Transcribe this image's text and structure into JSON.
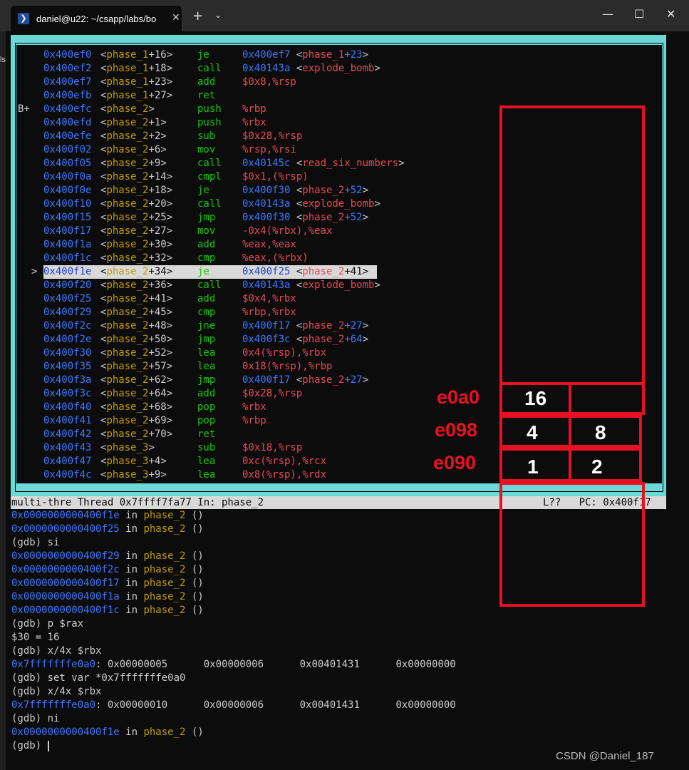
{
  "window": {
    "tab_title": "daniel@u22: ~/csapp/labs/bo",
    "tab_icon": "terminal-icon",
    "tab_close": "✕",
    "new_tab": "+",
    "dropdown": "⌄",
    "minimize": "—",
    "maximize": "☐",
    "close": "✕",
    "side_text": "ls"
  },
  "asm": {
    "lines": [
      {
        "marker": "",
        "addr": "0x400ef0",
        "func": "phase_1",
        "off": "+16",
        "op": "je",
        "t1": "0x400ef7",
        "tsym": "phase_1",
        "toff": "+23"
      },
      {
        "marker": "",
        "addr": "0x400ef2",
        "func": "phase_1",
        "off": "+18",
        "op": "call",
        "t1": "0x40143a",
        "tsym": "explode_bomb",
        "toff": ""
      },
      {
        "marker": "",
        "addr": "0x400ef7",
        "func": "phase_1",
        "off": "+23",
        "op": "add",
        "plain": "$0x8,%rsp"
      },
      {
        "marker": "",
        "addr": "0x400efb",
        "func": "phase_1",
        "off": "+27",
        "op": "ret",
        "plain": ""
      },
      {
        "marker": "B+",
        "addr": "0x400efc",
        "func": "phase_2",
        "off": "",
        "op": "push",
        "plain": "%rbp"
      },
      {
        "marker": "",
        "addr": "0x400efd",
        "func": "phase_2",
        "off": "+1",
        "op": "push",
        "plain": "%rbx"
      },
      {
        "marker": "",
        "addr": "0x400efe",
        "func": "phase_2",
        "off": "+2",
        "op": "sub",
        "plain": "$0x28,%rsp"
      },
      {
        "marker": "",
        "addr": "0x400f02",
        "func": "phase_2",
        "off": "+6",
        "op": "mov",
        "plain": "%rsp,%rsi"
      },
      {
        "marker": "",
        "addr": "0x400f05",
        "func": "phase_2",
        "off": "+9",
        "op": "call",
        "t1": "0x40145c",
        "tsym": "read_six_numbers",
        "toff": ""
      },
      {
        "marker": "",
        "addr": "0x400f0a",
        "func": "phase_2",
        "off": "+14",
        "op": "cmpl",
        "plain": "$0x1,(%rsp)"
      },
      {
        "marker": "",
        "addr": "0x400f0e",
        "func": "phase_2",
        "off": "+18",
        "op": "je",
        "t1": "0x400f30",
        "tsym": "phase_2",
        "toff": "+52"
      },
      {
        "marker": "",
        "addr": "0x400f10",
        "func": "phase_2",
        "off": "+20",
        "op": "call",
        "t1": "0x40143a",
        "tsym": "explode_bomb",
        "toff": ""
      },
      {
        "marker": "",
        "addr": "0x400f15",
        "func": "phase_2",
        "off": "+25",
        "op": "jmp",
        "t1": "0x400f30",
        "tsym": "phase_2",
        "toff": "+52"
      },
      {
        "marker": "",
        "addr": "0x400f17",
        "func": "phase_2",
        "off": "+27",
        "op": "mov",
        "plain": "-0x4(%rbx),%eax"
      },
      {
        "marker": "",
        "addr": "0x400f1a",
        "func": "phase_2",
        "off": "+30",
        "op": "add",
        "plain": "%eax,%eax"
      },
      {
        "marker": "",
        "addr": "0x400f1c",
        "func": "phase_2",
        "off": "+32",
        "op": "cmp",
        "plain": "%eax,(%rbx)"
      },
      {
        "marker": ">",
        "addr": "0x400f1e",
        "func": "phase_2",
        "off": "+34",
        "op": "je",
        "t1": "0x400f25",
        "tsym": "phase_2",
        "toff": "+41",
        "current": true
      },
      {
        "marker": "",
        "addr": "0x400f20",
        "func": "phase_2",
        "off": "+36",
        "op": "call",
        "t1": "0x40143a",
        "tsym": "explode_bomb",
        "toff": ""
      },
      {
        "marker": "",
        "addr": "0x400f25",
        "func": "phase_2",
        "off": "+41",
        "op": "add",
        "plain": "$0x4,%rbx"
      },
      {
        "marker": "",
        "addr": "0x400f29",
        "func": "phase_2",
        "off": "+45",
        "op": "cmp",
        "plain": "%rbp,%rbx"
      },
      {
        "marker": "",
        "addr": "0x400f2c",
        "func": "phase_2",
        "off": "+48",
        "op": "jne",
        "t1": "0x400f17",
        "tsym": "phase_2",
        "toff": "+27"
      },
      {
        "marker": "",
        "addr": "0x400f2e",
        "func": "phase_2",
        "off": "+50",
        "op": "jmp",
        "t1": "0x400f3c",
        "tsym": "phase_2",
        "toff": "+64"
      },
      {
        "marker": "",
        "addr": "0x400f30",
        "func": "phase_2",
        "off": "+52",
        "op": "lea",
        "plain": "0x4(%rsp),%rbx"
      },
      {
        "marker": "",
        "addr": "0x400f35",
        "func": "phase_2",
        "off": "+57",
        "op": "lea",
        "plain": "0x18(%rsp),%rbp"
      },
      {
        "marker": "",
        "addr": "0x400f3a",
        "func": "phase_2",
        "off": "+62",
        "op": "jmp",
        "t1": "0x400f17",
        "tsym": "phase_2",
        "toff": "+27"
      },
      {
        "marker": "",
        "addr": "0x400f3c",
        "func": "phase_2",
        "off": "+64",
        "op": "add",
        "plain": "$0x28,%rsp"
      },
      {
        "marker": "",
        "addr": "0x400f40",
        "func": "phase_2",
        "off": "+68",
        "op": "pop",
        "plain": "%rbx"
      },
      {
        "marker": "",
        "addr": "0x400f41",
        "func": "phase_2",
        "off": "+69",
        "op": "pop",
        "plain": "%rbp"
      },
      {
        "marker": "",
        "addr": "0x400f42",
        "func": "phase_2",
        "off": "+70",
        "op": "ret",
        "plain": ""
      },
      {
        "marker": "",
        "addr": "0x400f43",
        "func": "phase_3",
        "off": "",
        "op": "sub",
        "plain": "$0x18,%rsp"
      },
      {
        "marker": "",
        "addr": "0x400f47",
        "func": "phase_3",
        "off": "+4",
        "op": "lea",
        "plain": "0xc(%rsp),%rcx"
      },
      {
        "marker": "",
        "addr": "0x400f4c",
        "func": "phase_3",
        "off": "+9",
        "op": "lea",
        "plain": "0x8(%rsp),%rdx"
      }
    ]
  },
  "status": {
    "left": "multi-thre Thread 0x7ffff7fa77 In: phase_2",
    "right": "L??   PC: 0x400f17"
  },
  "console": [
    {
      "addr": "0x0000000000400f1e",
      "rest": " in ",
      "func": "phase_2",
      "tail": " ()"
    },
    {
      "addr": "0x0000000000400f25",
      "rest": " in ",
      "func": "phase_2",
      "tail": " ()"
    },
    {
      "text": "(gdb) si"
    },
    {
      "addr": "0x0000000000400f29",
      "rest": " in ",
      "func": "phase_2",
      "tail": " ()"
    },
    {
      "addr": "0x0000000000400f2c",
      "rest": " in ",
      "func": "phase_2",
      "tail": " ()"
    },
    {
      "addr": "0x0000000000400f17",
      "rest": " in ",
      "func": "phase_2",
      "tail": " ()"
    },
    {
      "addr": "0x0000000000400f1a",
      "rest": " in ",
      "func": "phase_2",
      "tail": " ()"
    },
    {
      "addr": "0x0000000000400f1c",
      "rest": " in ",
      "func": "phase_2",
      "tail": " ()"
    },
    {
      "text": "(gdb) p $rax"
    },
    {
      "text": "$30 = 16"
    },
    {
      "text": "(gdb) x/4x $rbx"
    },
    {
      "addr": "0x7fffffffe0a0",
      "rest": ": 0x00000005      0x00000006      0x00401431      0x00000000"
    },
    {
      "text": "(gdb) set var *0x7fffffffe0a0"
    },
    {
      "text": "(gdb) x/4x $rbx"
    },
    {
      "addr": "0x7fffffffe0a0",
      "rest": ": 0x00000010      0x00000006      0x00401431      0x00000000"
    },
    {
      "text": "(gdb) ni"
    },
    {
      "addr": "0x0000000000400f1e",
      "rest": " in ",
      "func": "phase_2",
      "tail": " ()"
    },
    {
      "text": "(gdb) ",
      "cursor": true
    }
  ],
  "annotations": {
    "labels": [
      "e0a0",
      "e098",
      "e090"
    ],
    "cells": [
      "16",
      "",
      "4",
      "8",
      "1",
      "2"
    ],
    "color": "#e81123"
  },
  "watermark": "CSDN @Daniel_187"
}
